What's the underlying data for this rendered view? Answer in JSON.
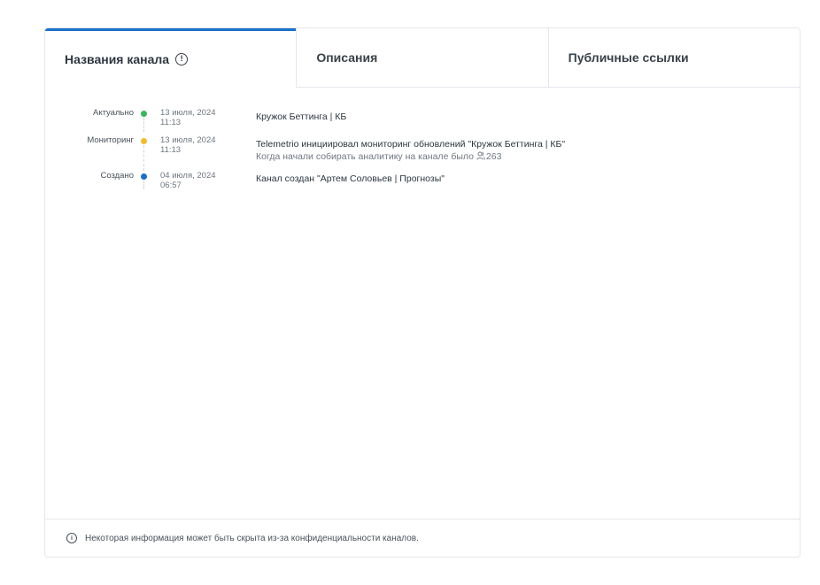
{
  "tabs": [
    {
      "label": "Названия канала",
      "active": true,
      "icon": "info-circle-icon"
    },
    {
      "label": "Описания",
      "active": false
    },
    {
      "label": "Публичные ссылки",
      "active": false
    }
  ],
  "timeline": [
    {
      "status": "Актуально",
      "dot_color": "#3cb55e",
      "date": "13 июля, 2024",
      "time": "11:13",
      "text": "Кружок Беттинга | КБ"
    },
    {
      "status": "Мониторинг",
      "dot_color": "#f0bd2e",
      "date": "13 июля, 2024",
      "time": "11:13",
      "text": "Telemetrio инициировал мониторинг обновлений \"Кружок Беттинга | КБ\"",
      "subtext": "Когда начали собирать аналитику на канале было",
      "subcount": "263",
      "subicon": "user-icon"
    },
    {
      "status": "Создано",
      "dot_color": "#1a6fc9",
      "date": "04 июля, 2024",
      "time": "06:57",
      "text": "Канал создан \"Артем Соловьев | Прогнозы\""
    }
  ],
  "footer": {
    "icon": "info-circle-icon",
    "text": "Некоторая информация может быть скрыта из-за конфиденциальности каналов."
  },
  "colors": {
    "accent": "#1a6fc9",
    "border": "#e4e7ea"
  }
}
